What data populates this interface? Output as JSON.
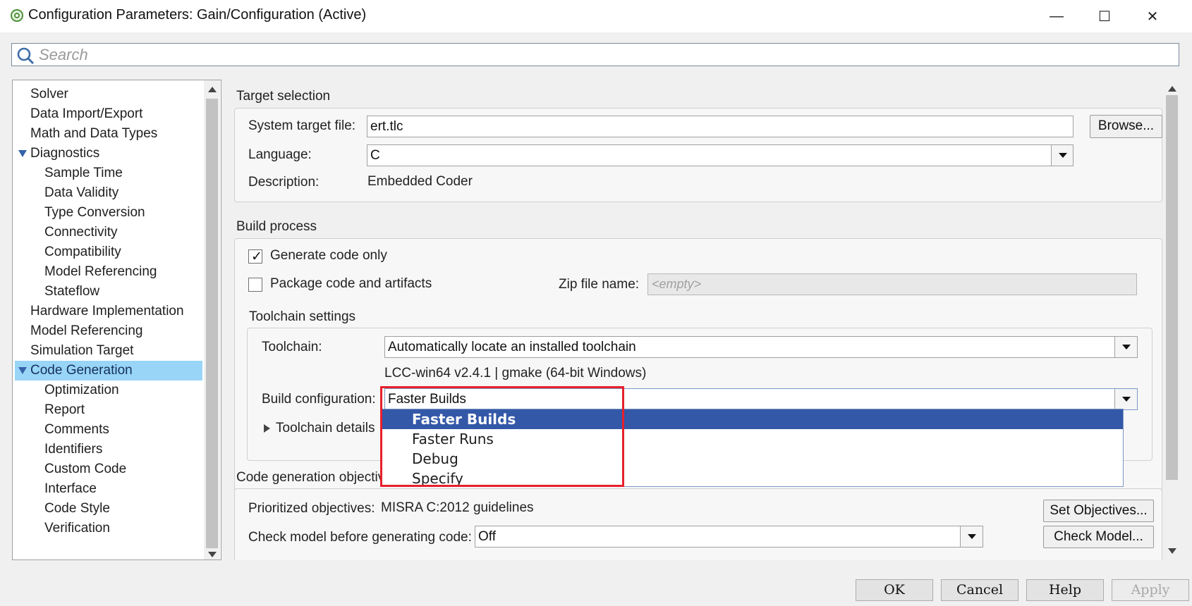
{
  "window": {
    "title": "Configuration Parameters: Gain/Configuration (Active)",
    "minimize_glyph": "—",
    "maximize_glyph": "☐",
    "close_glyph": "✕"
  },
  "search": {
    "placeholder": "Search"
  },
  "tree": {
    "items": [
      {
        "label": "Solver"
      },
      {
        "label": "Data Import/Export"
      },
      {
        "label": "Math and Data Types"
      },
      {
        "label": "Diagnostics"
      },
      {
        "label": "Sample Time"
      },
      {
        "label": "Data Validity"
      },
      {
        "label": "Type Conversion"
      },
      {
        "label": "Connectivity"
      },
      {
        "label": "Compatibility"
      },
      {
        "label": "Model Referencing"
      },
      {
        "label": "Stateflow"
      },
      {
        "label": "Hardware Implementation"
      },
      {
        "label": "Model Referencing"
      },
      {
        "label": "Simulation Target"
      },
      {
        "label": "Code Generation"
      },
      {
        "label": "Optimization"
      },
      {
        "label": "Report"
      },
      {
        "label": "Comments"
      },
      {
        "label": "Identifiers"
      },
      {
        "label": "Custom Code"
      },
      {
        "label": "Interface"
      },
      {
        "label": "Code Style"
      },
      {
        "label": "Verification"
      }
    ]
  },
  "target_selection": {
    "heading": "Target selection",
    "system_target_file_label": "System target file:",
    "system_target_file_value": "ert.tlc",
    "browse_button": "Browse...",
    "language_label": "Language:",
    "language_value": "C",
    "description_label": "Description:",
    "description_value": "Embedded Coder"
  },
  "build_process": {
    "heading": "Build process",
    "generate_code_only_label": "Generate code only",
    "package_code_label": "Package code and artifacts",
    "zip_file_label": "Zip file name:",
    "zip_file_placeholder": "<empty>",
    "toolchain_settings_heading": "Toolchain settings",
    "toolchain_label": "Toolchain:",
    "toolchain_value": "Automatically locate an installed toolchain",
    "toolchain_info": "LCC-win64 v2.4.1 | gmake (64-bit Windows)",
    "build_config_label": "Build configuration:",
    "build_config_value": "Faster Builds",
    "toolchain_details_label": "Toolchain details",
    "build_config_options": [
      "Faster Builds",
      "Faster Runs",
      "Debug",
      "Specify"
    ]
  },
  "objectives": {
    "heading": "Code generation objectives",
    "prioritized_label": "Prioritized objectives:",
    "prioritized_value": "MISRA C:2012 guidelines",
    "set_objectives_button": "Set Objectives...",
    "check_model_label": "Check model before generating code:",
    "check_model_value": "Off",
    "check_model_button": "Check Model..."
  },
  "footer": {
    "ok": "OK",
    "cancel": "Cancel",
    "help": "Help",
    "apply": "Apply"
  },
  "colors": {
    "selection": "#99d5f7",
    "dropdown_highlight": "#3458a8",
    "annotation_red": "#e8202c"
  }
}
